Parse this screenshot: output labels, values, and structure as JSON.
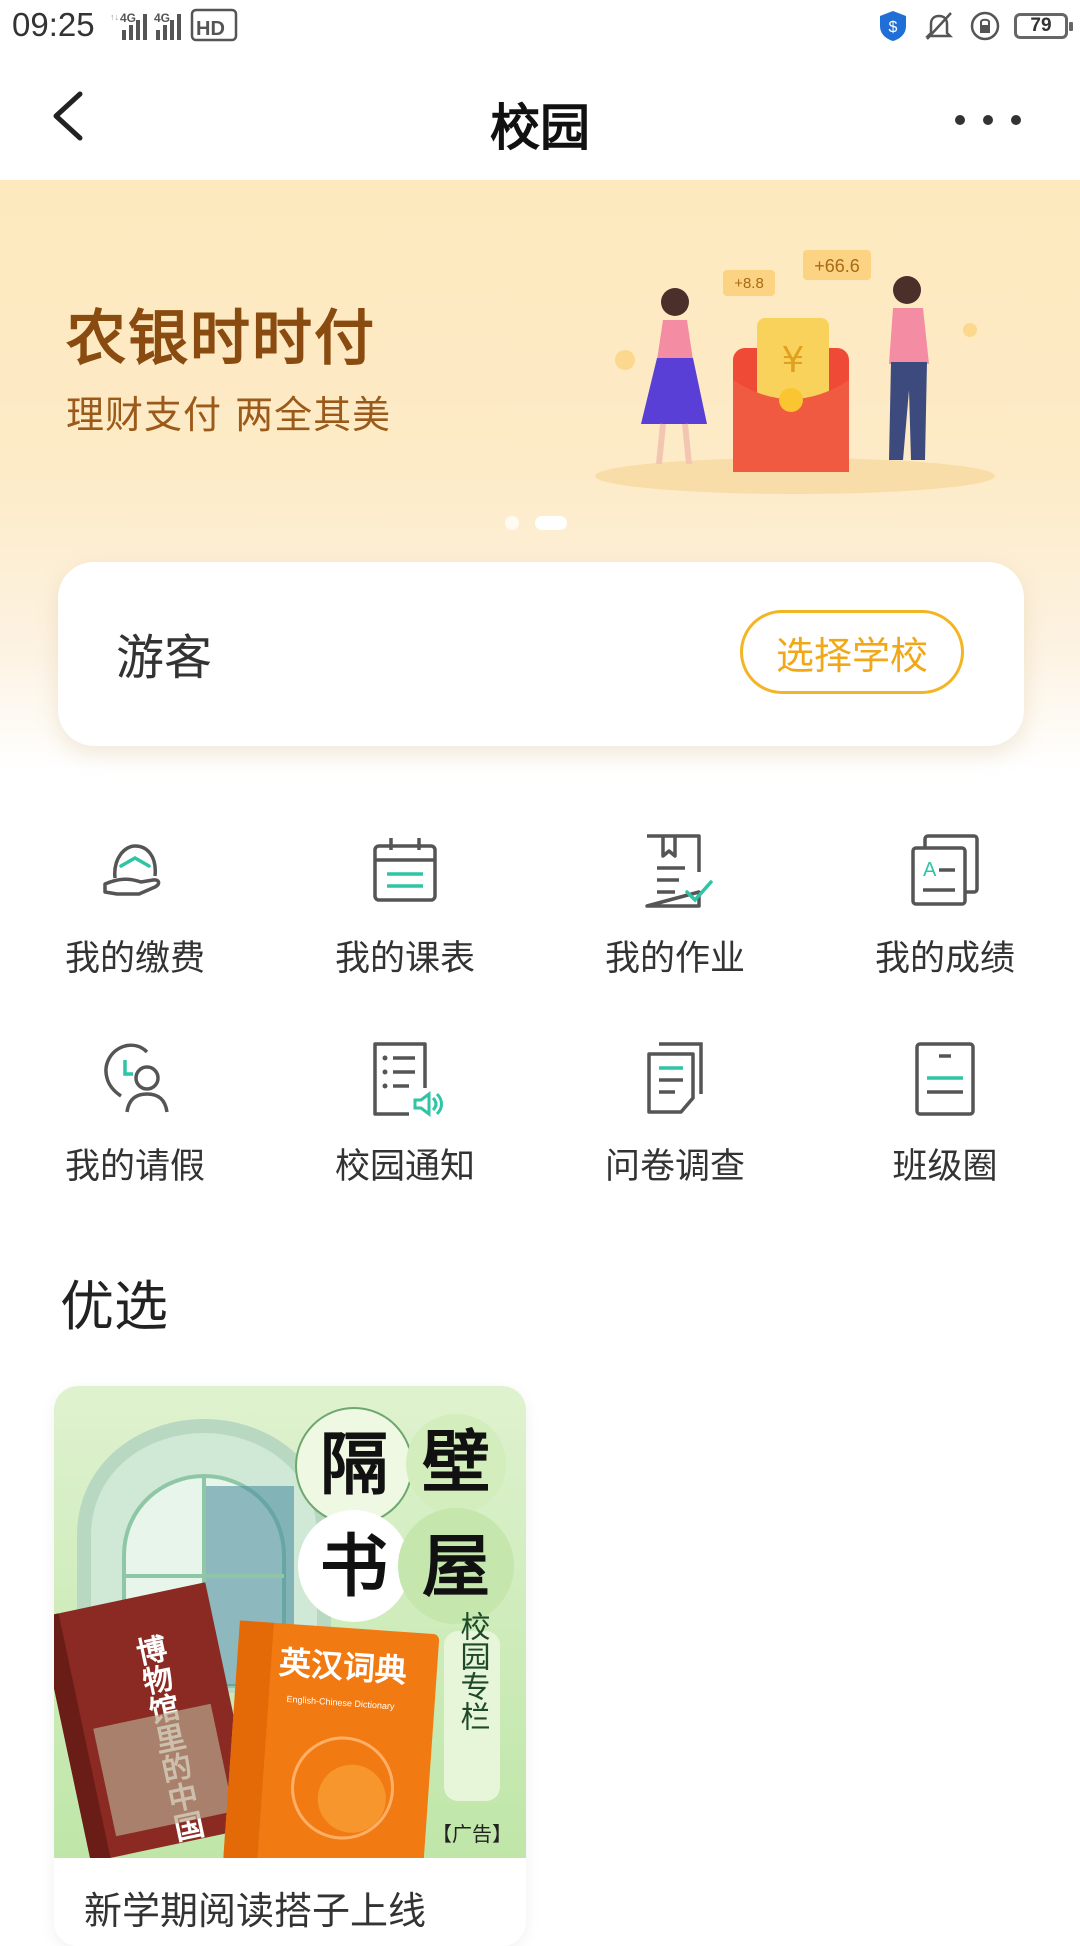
{
  "status": {
    "time": "09:25",
    "net1": "4G",
    "net2": "4G",
    "hd": "HD",
    "battery": "79"
  },
  "nav": {
    "title": "校园",
    "back_icon": "chevron-left-icon",
    "more_icon": "more-horizontal-icon"
  },
  "banner": {
    "title": "农银时时付",
    "subtitle": "理财支付 两全其美",
    "bubble1": "+8.8",
    "bubble2": "+66.6",
    "envelope_symbol": "¥",
    "active_dot": 1,
    "dot_count": 2
  },
  "guest": {
    "name": "游客",
    "choose_school": "选择学校"
  },
  "services": [
    {
      "label": "我的缴费",
      "icon": "payment-hand-icon"
    },
    {
      "label": "我的课表",
      "icon": "calendar-icon"
    },
    {
      "label": "我的作业",
      "icon": "homework-doc-icon"
    },
    {
      "label": "我的成绩",
      "icon": "grades-icon"
    },
    {
      "label": "我的请假",
      "icon": "leave-clock-user-icon"
    },
    {
      "label": "校园通知",
      "icon": "notice-speaker-icon"
    },
    {
      "label": "问卷调查",
      "icon": "survey-doc-icon"
    },
    {
      "label": "班级圈",
      "icon": "class-circle-icon"
    }
  ],
  "featured": {
    "section_title": "优选",
    "card": {
      "title": "新学期阅读搭子上线",
      "poster_char1": "隔",
      "poster_char2": "壁",
      "poster_char3": "书",
      "poster_char4": "屋",
      "book1_title": "博物馆里的中国",
      "book2_title": "英汉词典",
      "book2_sub": "English-Chinese Dictionary",
      "column_tag": "校园专栏",
      "ad_tag": "【广告】"
    }
  },
  "colors": {
    "accent": "#f3b524",
    "brand_brown": "#8a4b10",
    "icon_teal": "#2ec4a4"
  }
}
